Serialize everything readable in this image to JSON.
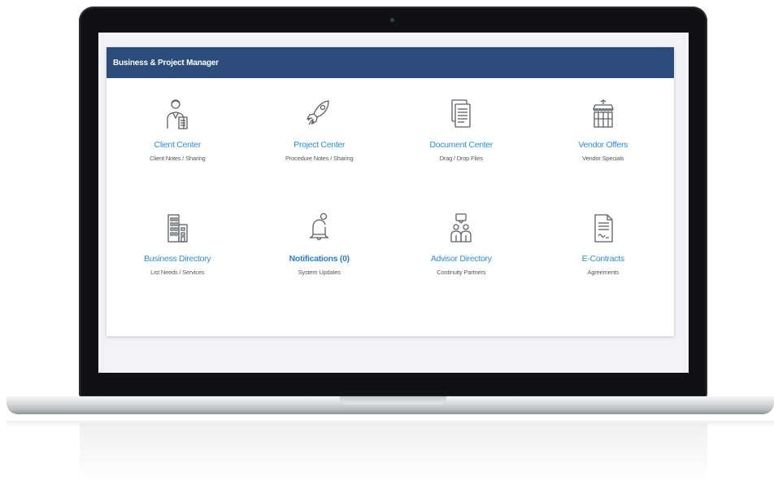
{
  "app": {
    "title": "Business & Project Manager"
  },
  "tiles": [
    {
      "title": "Client Center",
      "subtitle": "Client Notes / Sharing",
      "icon": "client-person-icon",
      "bold": false
    },
    {
      "title": "Project Center",
      "subtitle": "Procedure Notes / Sharing",
      "icon": "rocket-icon",
      "bold": false
    },
    {
      "title": "Document Center",
      "subtitle": "Drag / Drop Files",
      "icon": "documents-icon",
      "bold": false
    },
    {
      "title": "Vendor Offers",
      "subtitle": "Vendor Specials",
      "icon": "storefront-icon",
      "bold": false
    },
    {
      "title": "Business Directory",
      "subtitle": "List Needs / Services",
      "icon": "buildings-icon",
      "bold": false
    },
    {
      "title": "Notifications (0)",
      "subtitle": "System Updates",
      "icon": "bell-icon",
      "bold": true
    },
    {
      "title": "Advisor Directory",
      "subtitle": "Continuity Partners",
      "icon": "advisors-icon",
      "bold": false
    },
    {
      "title": "E-Contracts",
      "subtitle": "Agreements",
      "icon": "contract-icon",
      "bold": false
    }
  ],
  "colors": {
    "header": "#2c4c7c",
    "link": "#2b8fe0",
    "icon_stroke": "#5b6168"
  }
}
